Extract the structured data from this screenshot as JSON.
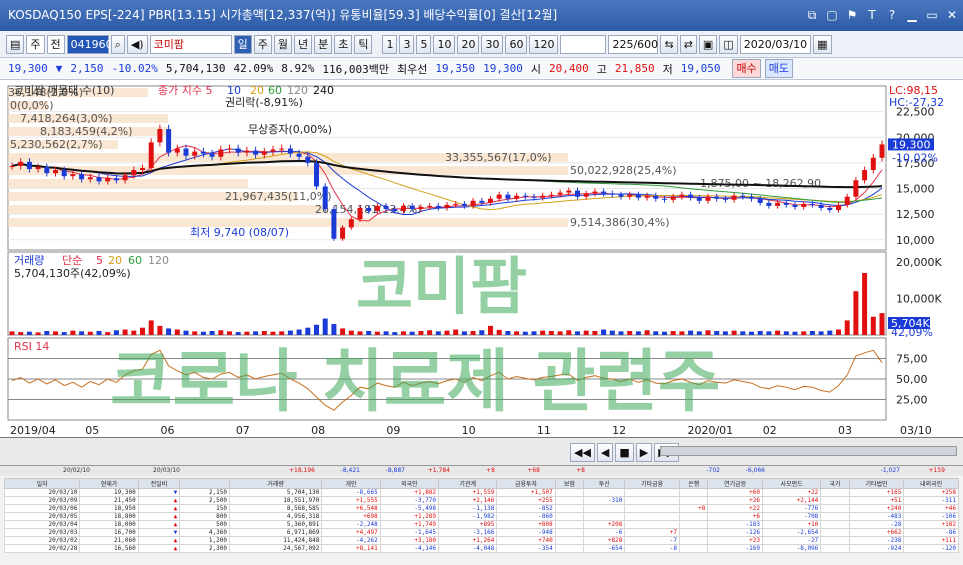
{
  "titlebar": {
    "text": "KOSDAQ150 EPS[-224] PBR[13.15] 시가총액[12,337(억)] 유통비율[59.3] 배당수익률[0] 결산[12월]",
    "icons": [
      "restore-icon",
      "window-icon",
      "pin-icon",
      "text-icon",
      "help-icon",
      "min-icon",
      "max-icon",
      "close-icon"
    ]
  },
  "toolbar": {
    "market": "주",
    "period": "전",
    "code": "041960",
    "name": "코미팜",
    "tabs": [
      "일",
      "주",
      "월",
      "년",
      "분",
      "초",
      "틱"
    ],
    "minutes": [
      "1",
      "3",
      "5",
      "10",
      "20",
      "30",
      "60",
      "120"
    ],
    "count": "225/600",
    "date": "2020/03/10"
  },
  "quote": {
    "price": "19,300",
    "arrow": "▼",
    "change": "2,150",
    "rate": "-10.02%",
    "volume": "5,704,130",
    "turnover": "42.09%",
    "pct2": "8.92%",
    "amount": "116,003백만",
    "priority": "최우선",
    "bid": "19,350",
    "ask": "19,300",
    "open_label": "시",
    "open": "20,400",
    "high_label": "고",
    "high": "21,850",
    "low_label": "저",
    "low": "19,050",
    "buy": "매수",
    "sell": "매도"
  },
  "chart_data": {
    "type": "line",
    "price_axis": [
      "22,500",
      "20,000",
      "17,500",
      "15,000",
      "12,500",
      "10,000"
    ],
    "price_range": [
      9000,
      25000
    ],
    "volume_axis": [
      "20,000K",
      "10,000K"
    ],
    "rsi_axis": [
      "75,00",
      "50,00",
      "25,00"
    ],
    "x_labels": [
      "2019/04",
      "05",
      "06",
      "07",
      "08",
      "09",
      "10",
      "11",
      "12",
      "2020/01",
      "02",
      "03",
      "03/10"
    ],
    "close": [
      17200,
      17600,
      16900,
      17100,
      16500,
      16800,
      16200,
      16400,
      15900,
      16100,
      15700,
      16000,
      15800,
      16300,
      16800,
      17000,
      19500,
      20800,
      18500,
      18900,
      18200,
      18600,
      18400,
      18100,
      18800,
      18900,
      18500,
      18700,
      18300,
      18600,
      18800,
      18900,
      18400,
      18100,
      17500,
      15200,
      13000,
      10100,
      11200,
      12000,
      13100,
      12800,
      13300,
      13000,
      12800,
      13300,
      13000,
      13200,
      13300,
      13100,
      13400,
      13500,
      13300,
      13800,
      13600,
      14000,
      14400,
      14000,
      14300,
      14200,
      14100,
      14300,
      14400,
      14600,
      14800,
      14200,
      14500,
      14700,
      14500,
      14400,
      14200,
      14400,
      14100,
      14300,
      14000,
      13900,
      14200,
      14400,
      14100,
      13800,
      14200,
      14000,
      13900,
      14300,
      14200,
      14000,
      13600,
      13300,
      13600,
      13400,
      13200,
      13500,
      13400,
      13100,
      12900,
      13400,
      14200,
      15800,
      16800,
      18000,
      19300
    ],
    "volume": [
      1.0,
      0.8,
      0.9,
      0.7,
      1.1,
      1.0,
      0.8,
      1.2,
      1.0,
      0.9,
      1.1,
      0.8,
      1.3,
      1.5,
      1.2,
      2.0,
      4.0,
      2.5,
      1.8,
      1.5,
      1.2,
      1.0,
      0.9,
      1.1,
      1.3,
      1.0,
      0.8,
      0.9,
      1.0,
      1.1,
      0.9,
      1.0,
      1.2,
      1.5,
      2.0,
      2.8,
      4.5,
      3.0,
      1.8,
      1.2,
      1.0,
      1.1,
      0.9,
      1.0,
      0.8,
      1.0,
      0.9,
      1.1,
      1.3,
      1.0,
      1.2,
      1.5,
      1.0,
      1.1,
      1.3,
      2.5,
      1.4,
      1.1,
      1.0,
      0.9,
      1.0,
      1.2,
      1.1,
      1.0,
      1.3,
      1.0,
      1.2,
      1.1,
      1.5,
      1.2,
      1.0,
      1.1,
      1.0,
      1.3,
      1.0,
      0.9,
      1.1,
      1.0,
      1.2,
      1.0,
      1.3,
      1.1,
      1.0,
      1.2,
      1.0,
      0.9,
      1.1,
      1.0,
      1.2,
      1.0,
      0.9,
      1.0,
      1.1,
      1.0,
      1.2,
      1.5,
      4.0,
      12.0,
      17.0,
      5.0,
      6.0
    ],
    "rsi": [
      48,
      52,
      45,
      50,
      44,
      49,
      42,
      46,
      40,
      47,
      43,
      50,
      46,
      55,
      60,
      62,
      80,
      85,
      66,
      60,
      55,
      58,
      52,
      50,
      56,
      58,
      52,
      55,
      50,
      53,
      55,
      57,
      50,
      45,
      38,
      28,
      18,
      12,
      22,
      30,
      40,
      38,
      45,
      42,
      40,
      46,
      42,
      45,
      47,
      44,
      48,
      50,
      46,
      52,
      48,
      54,
      58,
      50,
      53,
      51,
      49,
      52,
      53,
      55,
      56,
      48,
      52,
      54,
      51,
      50,
      47,
      50,
      46,
      49,
      45,
      44,
      48,
      50,
      46,
      43,
      48,
      46,
      45,
      49,
      47,
      45,
      40,
      38,
      42,
      40,
      37,
      41,
      40,
      36,
      34,
      42,
      55,
      78,
      82,
      85,
      70
    ],
    "labels": {
      "ma": "코미팜 매물대 수(10)",
      "ma_index": "종가 지수 5",
      "ma_periods": [
        "10",
        "20",
        "60",
        "120",
        "240"
      ],
      "rights": "권리락(-8,91%)",
      "bonus": "무상증자(0,00%)",
      "lc": "LC:98,15",
      "hc": "HC:-27,32",
      "rate_tag": "-10,02%",
      "price_tag": "19,300",
      "low_mark": "최저 9,740 (08/07)",
      "vol_title": "거래량",
      "vol_ma": "단순",
      "vol_ma_periods": [
        "5",
        "20",
        "60",
        "120"
      ],
      "vol_val": "5,704,130주(42,09%)",
      "vol_tag": "5,704K",
      "vol_pct": "42,09%",
      "rsi_title": "RSI 14"
    },
    "bands": [
      "36,148(2,0%)",
      "0(0,0%)",
      "7,418,264(3,0%)",
      "8,183,459(4,2%)",
      "5,230,562(2,7%)",
      "33,355,567(17,0%)",
      "50,022,928(25,4%)",
      "1,875,00 ~ 18,262,90",
      "21,967,435(11,0%)",
      "26,154,181(13,4%)",
      "9,514,386(30,4%)"
    ]
  },
  "overlay": {
    "line1": "코미팜",
    "line2": "코로나 치료제 관련주"
  },
  "table": {
    "toprow": [
      "",
      "20/02/10",
      "",
      "20/03/10",
      "",
      "",
      "+18,196",
      "-8,421",
      "-8,887",
      "+1,784",
      "+8",
      "+68",
      "+8",
      "",
      "",
      "-702",
      "-6,066",
      "",
      "",
      "-1,027",
      "+159"
    ],
    "headers": [
      "일자",
      "현재가",
      "전일비",
      "",
      "거래량",
      "개인",
      "외국인",
      "기관계",
      "금융투자",
      "보험",
      "투신",
      "기타금융",
      "은행",
      "연기금등",
      "사모펀드",
      "국가",
      "기타법인",
      "내외국인"
    ],
    "rows": [
      [
        "20/03/10",
        "19,300",
        "▼",
        "2,150",
        "5,704,130",
        "-8,665",
        "+1,882",
        "+1,559",
        "+1,507",
        "",
        "",
        "",
        "",
        "+60",
        "+22",
        "",
        "+165",
        "+258"
      ],
      [
        "20/03/09",
        "21,450",
        "▲",
        "2,500",
        "18,551,970",
        "+1,555",
        "-3,770",
        "+2,146",
        "+255",
        "",
        "-310",
        "",
        "",
        "+26",
        "+2,144",
        "",
        "+51",
        "-311"
      ],
      [
        "20/03/06",
        "18,950",
        "▲",
        "150",
        "8,568,585",
        "+6,548",
        "-5,498",
        "-1,138",
        "-852",
        "",
        "",
        "",
        "+8",
        "+22",
        "-776",
        "",
        "+240",
        "+46"
      ],
      [
        "20/03/05",
        "18,800",
        "▲",
        "800",
        "4,956,318",
        "+698",
        "+1,289",
        "-1,982",
        "-860",
        "",
        "",
        "",
        "",
        "+6",
        "-708",
        "",
        "-483",
        "-106"
      ],
      [
        "20/03/04",
        "18,000",
        "▲",
        "500",
        "5,360,891",
        "-2,248",
        "+1,749",
        "+895",
        "+808",
        "",
        "+208",
        "",
        "",
        "-183",
        "+10",
        "",
        "-28",
        "+182"
      ],
      [
        "20/03/03",
        "16,700",
        "▼",
        "4,360",
        "6,971,869",
        "+4,497",
        "-1,645",
        "-3,166",
        "-948",
        "",
        "-6",
        "+7",
        "",
        "-126",
        "-2,654",
        "",
        "+662",
        "-86"
      ],
      [
        "20/03/02",
        "21,060",
        "▲",
        "1,200",
        "11,424,848",
        "-4,262",
        "+3,180",
        "+1,264",
        "+740",
        "",
        "+828",
        "-7",
        "",
        "+23",
        "-27",
        "",
        "-238",
        "+111"
      ],
      [
        "20/02/28",
        "16,560",
        "▲",
        "2,300",
        "24,567,092",
        "+8,141",
        "-4,146",
        "-4,048",
        "-354",
        "",
        "-654",
        "-8",
        "",
        "-169",
        "-8,096",
        "",
        "-924",
        "-120"
      ]
    ]
  }
}
